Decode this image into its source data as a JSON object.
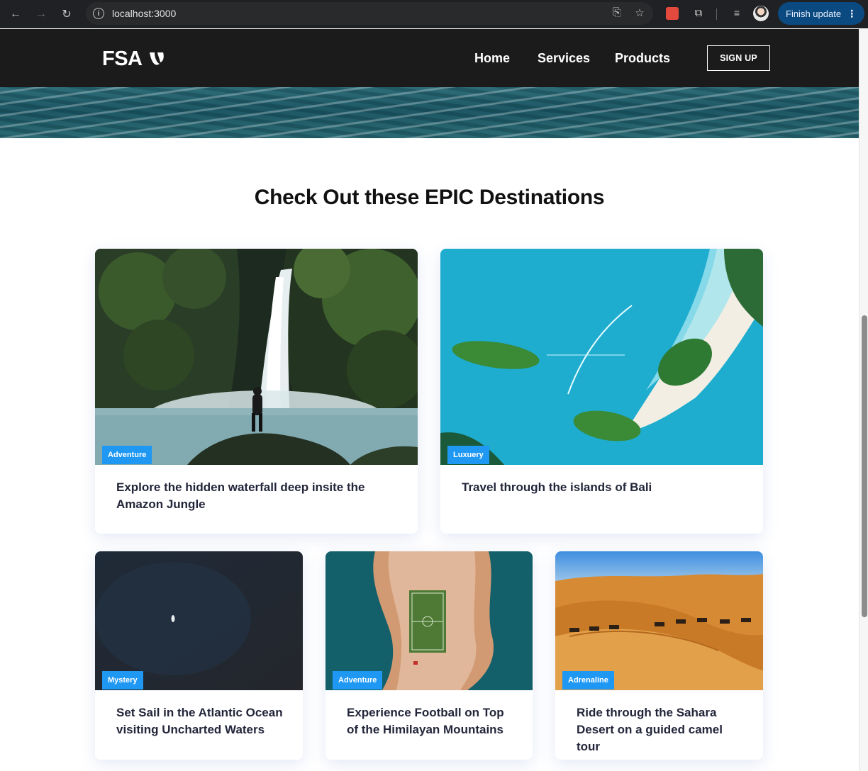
{
  "browser": {
    "url": "localhost:3000",
    "update_button": "Finish update"
  },
  "nav": {
    "logo": "FSA",
    "links": [
      "Home",
      "Services",
      "Products"
    ],
    "signup": "SIGN UP"
  },
  "section": {
    "title": "Check Out these EPIC Destinations"
  },
  "cards": [
    {
      "tag": "Adventure",
      "title": "Explore the hidden waterfall deep insite the Amazon Jungle",
      "image": "waterfall"
    },
    {
      "tag": "Luxuery",
      "title": "Travel through the islands of Bali",
      "image": "islands"
    },
    {
      "tag": "Mystery",
      "title": "Set Sail in the Atlantic Ocean visiting Uncharted Waters",
      "image": "ocean"
    },
    {
      "tag": "Adventure",
      "title": "Experience Football on Top of the Himilayan Mountains",
      "image": "football-field"
    },
    {
      "tag": "Adrenaline",
      "title": "Ride through the Sahara Desert on a guided camel tour",
      "image": "desert"
    }
  ],
  "colors": {
    "tag_bg": "#1f98f4",
    "nav_bg": "#1c1b1b",
    "title_text": "#23263a"
  }
}
